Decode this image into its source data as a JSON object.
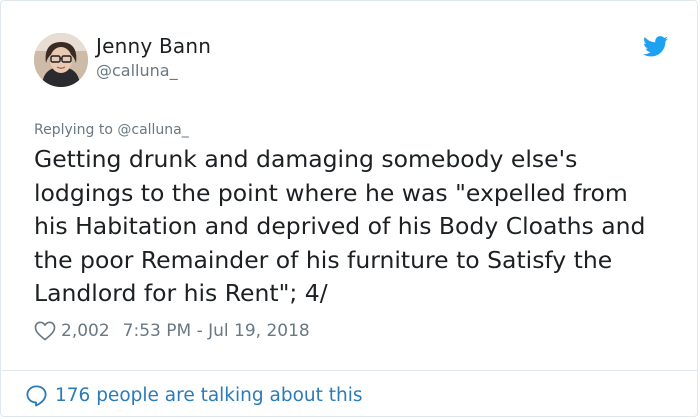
{
  "author": {
    "display_name": "Jenny Bann",
    "handle": "@calluna_",
    "avatar_icon": "profile-photo"
  },
  "brand": {
    "logo_icon": "twitter-bird-icon",
    "accent": "#1da1f2"
  },
  "tweet": {
    "replying_to": "Replying to @calluna_",
    "text": "Getting drunk and damaging somebody else's\nlodgings to the point where he was \"expelled from\nhis Habitation and deprived of his Body Cloaths and\nthe poor Remainder of his furniture to Satisfy the\nLandlord for his Rent\"; 4/",
    "likes": "2,002",
    "timestamp": "7:53 PM - Jul 19, 2018"
  },
  "footer": {
    "conversation_text": "176 people are talking about this",
    "link_color": "#2b7bb9"
  }
}
